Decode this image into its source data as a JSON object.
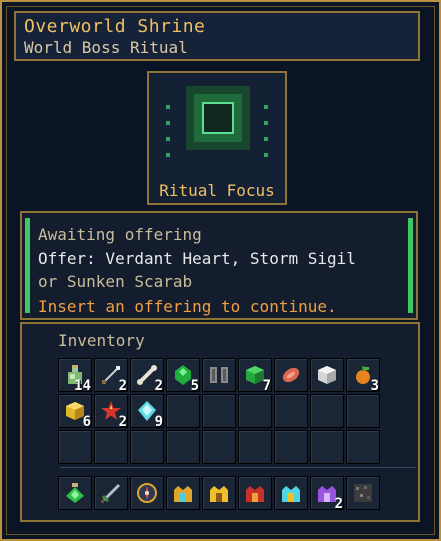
{
  "header": {
    "title": "Overworld Shrine",
    "subtitle": "World Boss Ritual"
  },
  "focus": {
    "label": "Ritual Focus"
  },
  "status": {
    "line1": "Awaiting offering",
    "line2": "Offer: Verdant Heart, Storm Sigil",
    "line3": "or Sunken Scarab",
    "line4": "Insert an offering to continue.",
    "accent": "#3fc765"
  },
  "inventory": {
    "label": "Inventory",
    "row1": [
      {
        "icon": "potion-icon",
        "count": "14"
      },
      {
        "icon": "arrow-icon",
        "count": "2"
      },
      {
        "icon": "bone-icon",
        "count": "2"
      },
      {
        "icon": "emerald-icon",
        "count": "5"
      },
      {
        "icon": "boots-icon",
        "count": ""
      },
      {
        "icon": "green-cube-icon",
        "count": "7"
      },
      {
        "icon": "raw-meat-icon",
        "count": ""
      },
      {
        "icon": "white-block-icon",
        "count": ""
      },
      {
        "icon": "orange-fruit-icon",
        "count": "3"
      }
    ],
    "row2": [
      {
        "icon": "gold-block-icon",
        "count": "6"
      },
      {
        "icon": "red-star-icon",
        "count": "2"
      },
      {
        "icon": "diamond-icon",
        "count": "9"
      }
    ],
    "hotbar": [
      {
        "icon": "green-flask-icon",
        "count": ""
      },
      {
        "icon": "sword-icon",
        "count": ""
      },
      {
        "icon": "compass-icon",
        "count": ""
      },
      {
        "icon": "gold-crown-icon",
        "count": ""
      },
      {
        "icon": "yellow-crown-icon",
        "count": ""
      },
      {
        "icon": "red-crown-icon",
        "count": ""
      },
      {
        "icon": "cyan-crown-icon",
        "count": ""
      },
      {
        "icon": "purple-crown-icon",
        "count": "2"
      },
      {
        "icon": "stone-block-icon",
        "count": ""
      }
    ]
  }
}
